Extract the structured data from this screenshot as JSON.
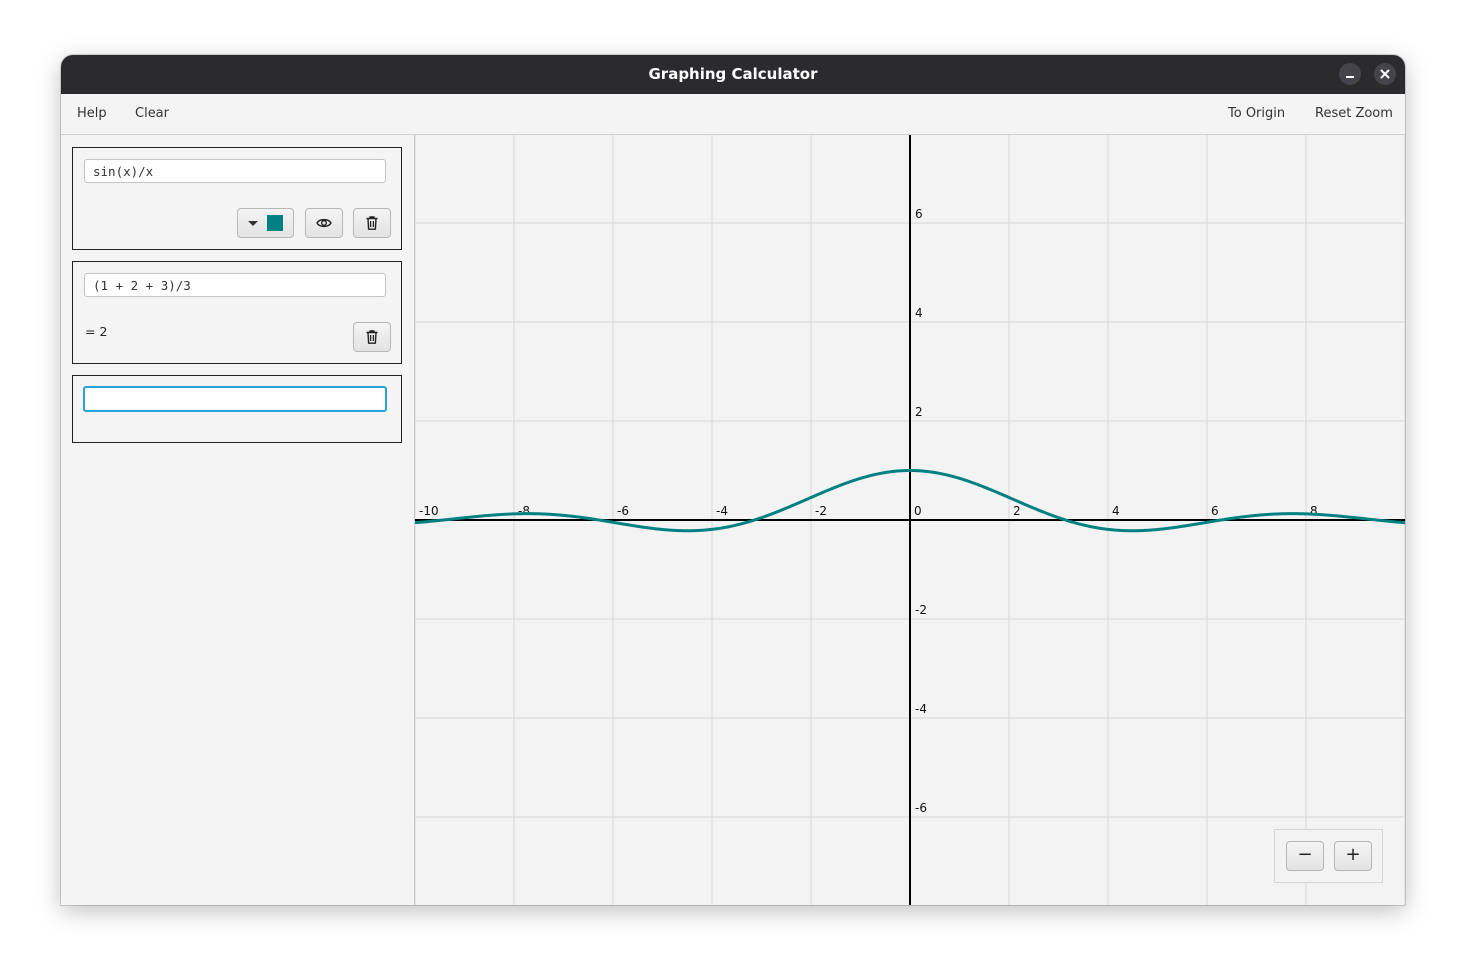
{
  "window": {
    "title": "Graphing Calculator",
    "minimize_icon": "minimize-icon",
    "close_icon": "close-icon"
  },
  "menu": {
    "left": [
      "Help",
      "Clear"
    ],
    "right": [
      "To Origin",
      "Reset Zoom"
    ]
  },
  "expressions": [
    {
      "text": "sin(x)/x",
      "color": "#008080",
      "controls": [
        "color-picker",
        "visibility-toggle",
        "delete"
      ]
    },
    {
      "text": "(1 + 2 + 3)/3",
      "result": "= 2",
      "controls": [
        "delete"
      ]
    },
    {
      "text": "",
      "focused": true
    }
  ],
  "icons": {
    "dropdown": "chevron-down-icon",
    "eye": "eye-icon",
    "trash": "trash-icon"
  },
  "colors": {
    "curve": "#008080",
    "grid": "#dcdcdc",
    "axis": "#000000",
    "focus": "#2aa3dd",
    "titlebar": "#2b2b2e"
  },
  "zoom": {
    "minus_label": "−",
    "plus_label": "+"
  },
  "chart_data": {
    "type": "line",
    "function": "sin(x)/x",
    "series": [
      {
        "name": "sin(x)/x",
        "color": "#008080"
      }
    ],
    "xlim": [
      -10,
      10
    ],
    "ylim": [
      -7.8,
      7.8
    ],
    "grid": true,
    "x_ticks": [
      "-10",
      "-8",
      "-6",
      "-4",
      "-2",
      "0",
      "2",
      "4",
      "6",
      "8"
    ],
    "y_ticks": [
      "6",
      "4",
      "2",
      "-2",
      "-4",
      "-6"
    ]
  }
}
